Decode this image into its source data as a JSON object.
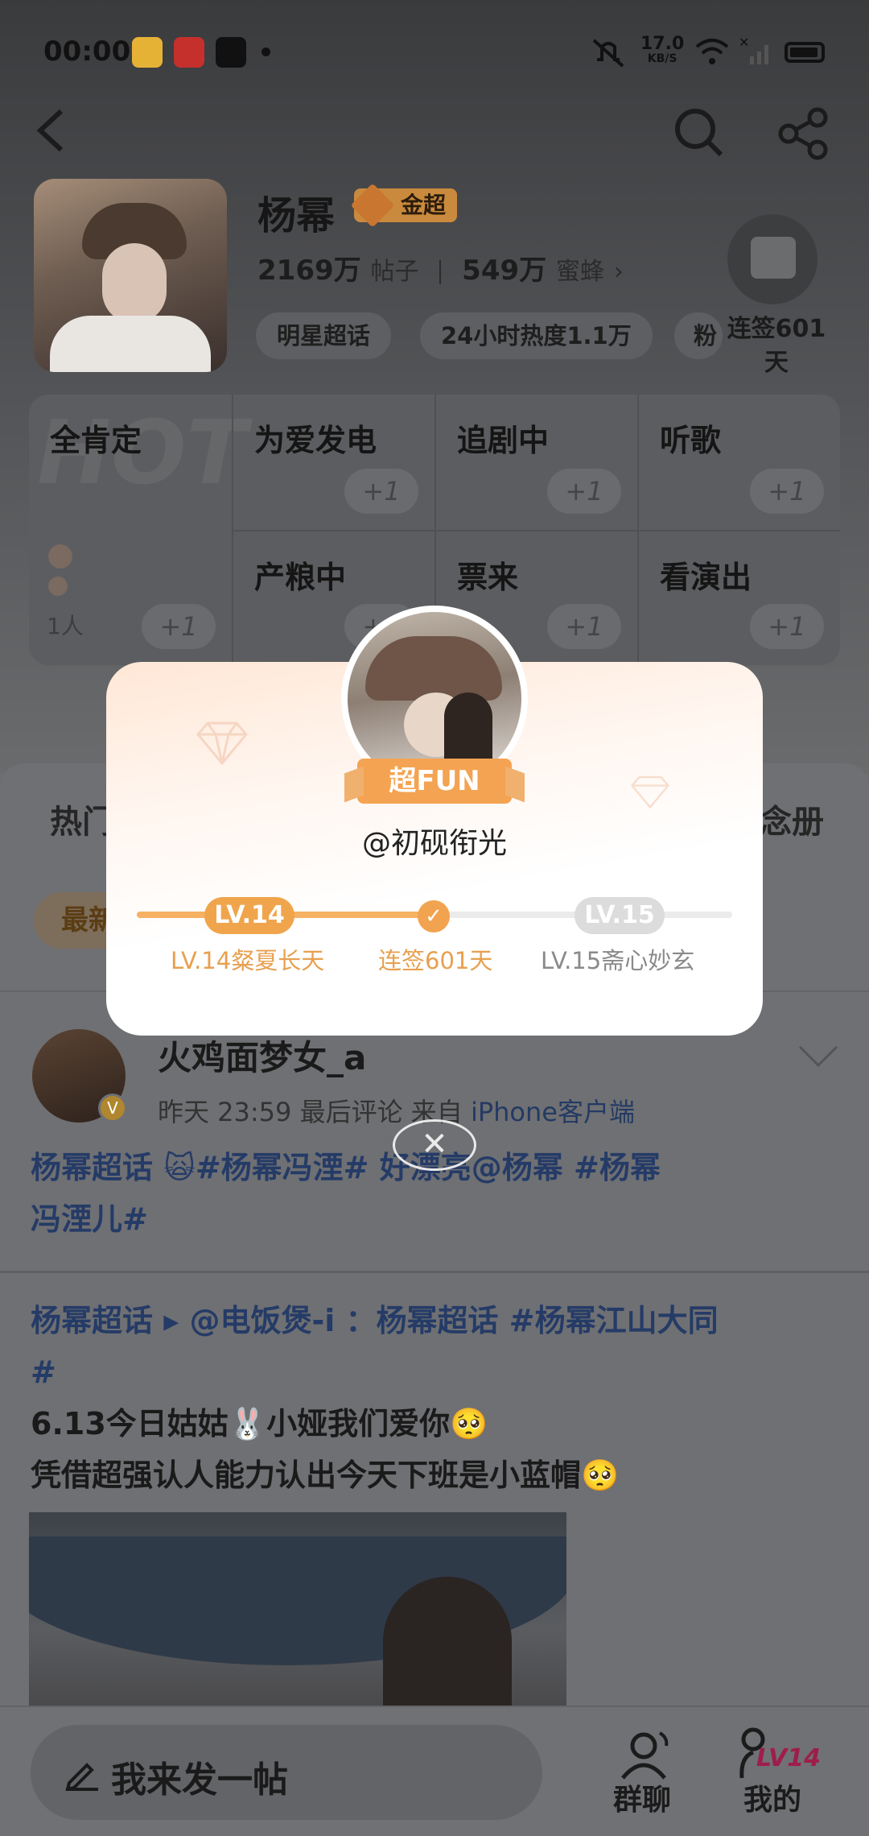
{
  "status_bar": {
    "time": "00:00",
    "network_speed": "17.0",
    "network_unit": "KB/S",
    "notification_apps": [
      "weibo-icon",
      "tmall-618-icon",
      "tiktok-icon"
    ]
  },
  "header": {
    "star_name": "杨幂",
    "badge_label": "金超",
    "posts_count": "2169万",
    "posts_label": "帖子",
    "fans_count": "549万",
    "fans_label": "蜜蜂",
    "chips": [
      "明星超话",
      "24小时热度1.1万",
      "粉"
    ],
    "checkin_label": "连签601天"
  },
  "mood": {
    "watermark": "HOT",
    "items": [
      {
        "title": "全肯定",
        "plus": "+1",
        "count": "1人"
      },
      {
        "title": "为爱发电",
        "plus": "+1"
      },
      {
        "title": "追剧中",
        "plus": "+1"
      },
      {
        "title": "听歌",
        "plus": "+1"
      },
      {
        "title": "产粮中",
        "plus": "+1"
      },
      {
        "title": "票来",
        "plus": "+1"
      },
      {
        "title": "看演出",
        "plus": "+1"
      }
    ],
    "mini_avatar_plus": "+1"
  },
  "tabs": {
    "left_partial": "热门",
    "right_partial": "念册",
    "filter_partial": "最新"
  },
  "popup": {
    "badge": "超FUN",
    "username": "@初砚衔光",
    "current_level": "LV.14",
    "next_level": "LV.15",
    "current_caption": "LV.14粲夏长天",
    "middle_caption": "连签601天",
    "next_caption": "LV.15斋心妙玄",
    "progress": 0.5,
    "close_symbol": "✕"
  },
  "post": {
    "username": "火鸡面梦女_a",
    "time": "昨天  23:59",
    "meta_middle": "最后评论  来自",
    "source": "iPhone客户端",
    "verified_mark": "V",
    "line1": "杨幂超话    🙀#杨幂冯湮#  好漂亮@杨幂 #杨幂",
    "line2": "冯湮儿#"
  },
  "repost": {
    "line1": "杨幂超话 ▸ @电饭煲-i ：杨幂超话 #杨幂江山大同",
    "line2": "#",
    "line3": "6.13今日姑姑🐰小娅我们爱你🥺",
    "line4": "凭借超强认人能力认出今天下班是小蓝帽🥺"
  },
  "bottom_bar": {
    "compose_placeholder": "我来发一帖",
    "group_chat_label": "群聊",
    "mine_label": "我的",
    "mine_level": "LV14"
  },
  "colors": {
    "accent_orange": "#f0a54c",
    "link_blue": "#253b67",
    "dim_overlay": "#6d6e70"
  }
}
